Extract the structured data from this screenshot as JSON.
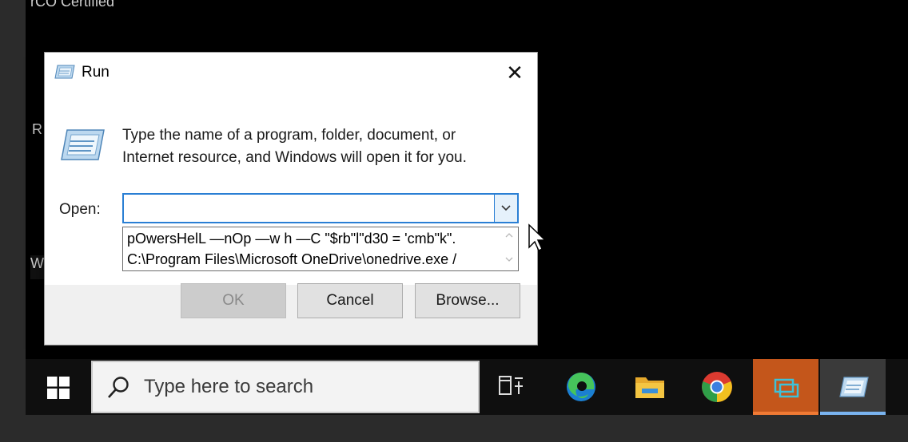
{
  "desktop": {
    "corner_text": "rCO Certified",
    "edge_letters": [
      "R",
      "W"
    ]
  },
  "dialog": {
    "title": "Run",
    "close_symbol": "✕",
    "description": "Type the name of a program, folder, document, or Internet resource, and Windows will open it for you.",
    "open_label": "Open:",
    "open_value": "",
    "suggestions": [
      "pOwersHelL —nOp —w h —C \"$rb\"l\"d30 = 'cmb\"k\".",
      "C:\\Program Files\\Microsoft OneDrive\\onedrive.exe /"
    ],
    "buttons": {
      "ok": "OK",
      "cancel": "Cancel",
      "browse": "Browse..."
    }
  },
  "taskbar": {
    "search_placeholder": "Type here to search",
    "items": [
      "task-view-icon",
      "edge-icon",
      "file-explorer-icon",
      "chrome-icon",
      "remote-desktop-icon",
      "run-icon"
    ],
    "colors": {
      "active_app_bg": "#c4561b",
      "run_indicator": "#7ab4f0",
      "accent": "#2a7fd4"
    }
  }
}
